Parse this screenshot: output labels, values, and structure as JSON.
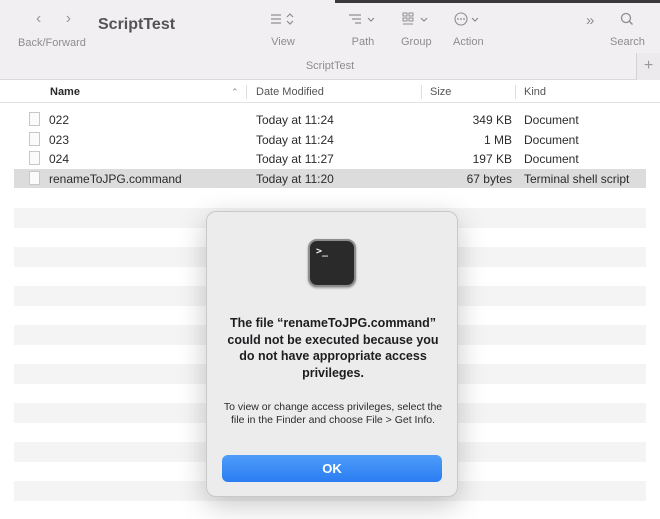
{
  "toolbar": {
    "back_forward_label": "Back/Forward",
    "window_title": "ScriptTest",
    "view_label": "View",
    "path_label": "Path",
    "group_label": "Group",
    "action_label": "Action",
    "search_label": "Search",
    "tab_title": "ScriptTest",
    "nav_glyph": "‹ ›",
    "more_glyph": "»",
    "plus_glyph": "+"
  },
  "columns": {
    "name": "Name",
    "date_modified": "Date Modified",
    "size": "Size",
    "kind": "Kind"
  },
  "files": [
    {
      "name": "022",
      "date": "Today at 11:24",
      "size": "349 KB",
      "kind": "Document"
    },
    {
      "name": "023",
      "date": "Today at 11:24",
      "size": "1 MB",
      "kind": "Document"
    },
    {
      "name": "024",
      "date": "Today at 11:27",
      "size": "197 KB",
      "kind": "Document"
    },
    {
      "name": "renameToJPG.command",
      "date": "Today at 11:20",
      "size": "67 bytes",
      "kind": "Terminal shell script",
      "selected": true
    }
  ],
  "alert": {
    "title": "The file “renameToJPG.command” could not be executed because you do not have appropriate access privileges.",
    "message": "To view or change access privileges, select the file in the Finder and choose File > Get Info.",
    "ok_label": "OK",
    "terminal_prompt": ">_"
  },
  "colors": {
    "accent": "#2a7cf2",
    "toolbar_bg": "#f1eff1",
    "stripe": "#f4f4f4",
    "selection": "#dcdcdc"
  },
  "icons": {
    "view": "list-view-icon",
    "path": "path-icon",
    "group": "group-icon",
    "action": "action-icon",
    "search": "search-icon"
  }
}
